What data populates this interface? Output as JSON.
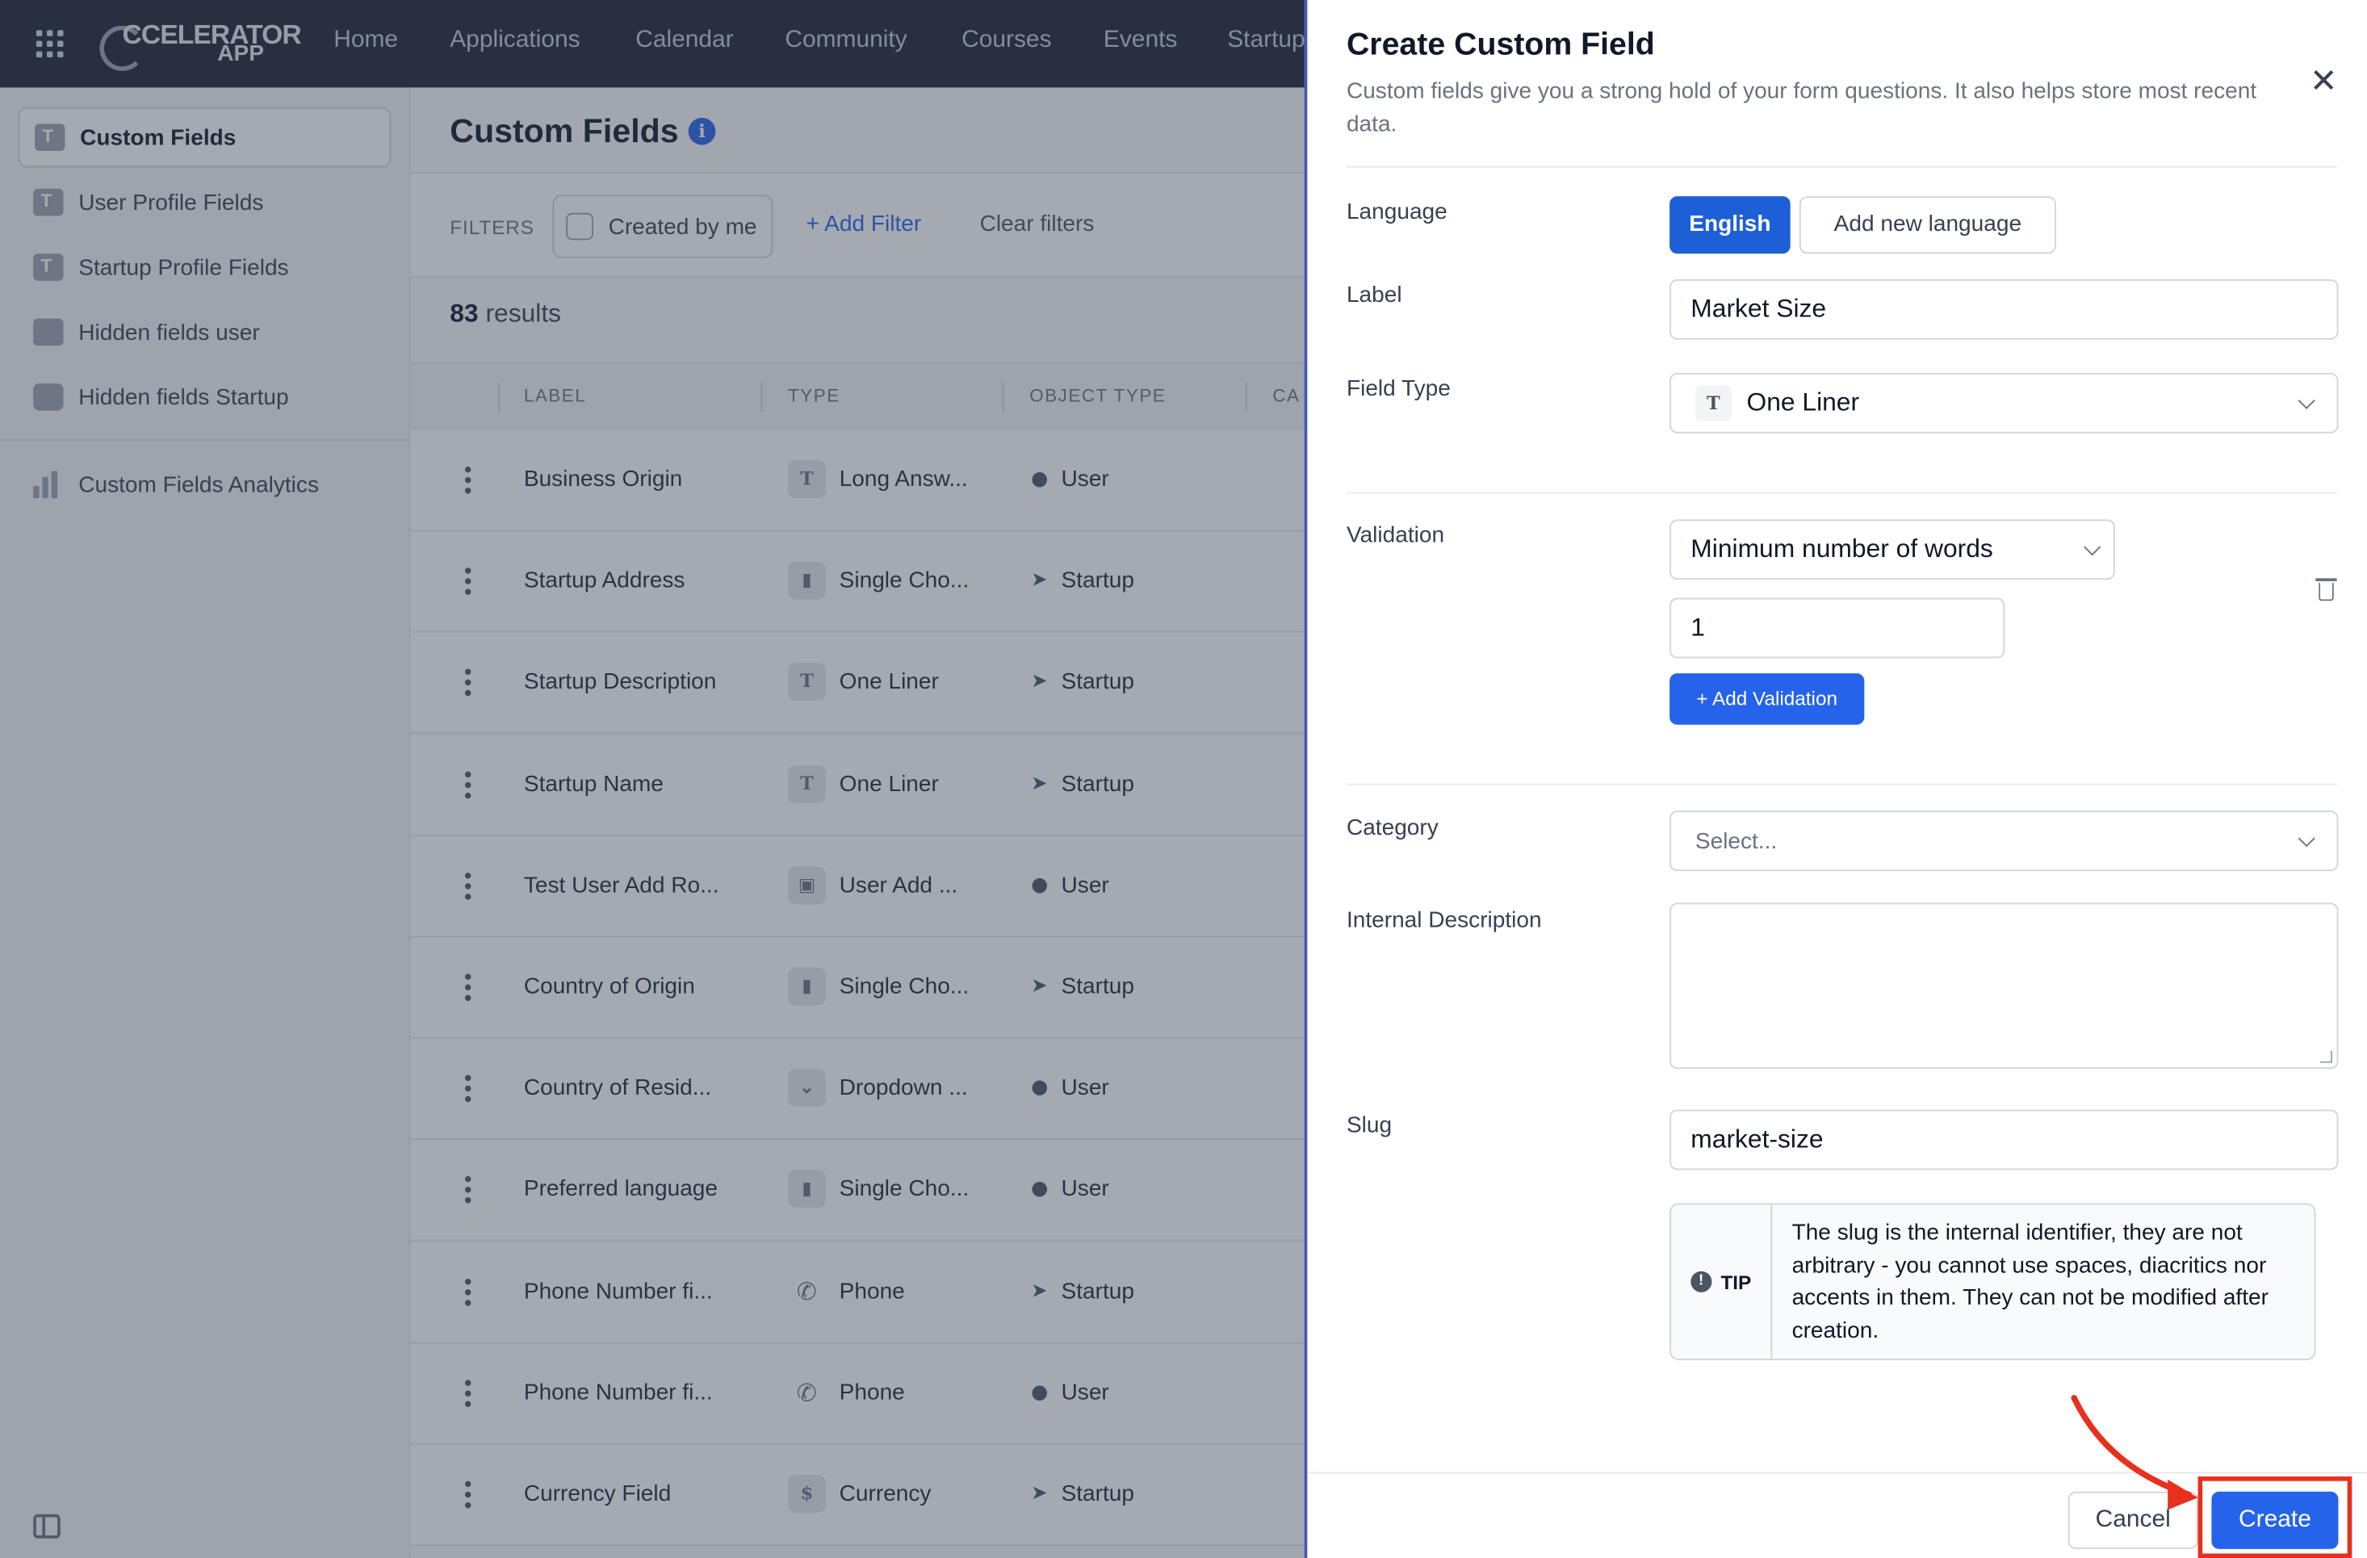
{
  "topnav": {
    "logo_line1": "CCELERATOR",
    "logo_line2": "APP",
    "items": [
      "Home",
      "Applications",
      "Calendar",
      "Community",
      "Courses",
      "Events",
      "Startup"
    ]
  },
  "sidebar": {
    "items": [
      {
        "label": "Custom Fields",
        "icon": "text-field-icon",
        "active": true
      },
      {
        "label": "User Profile Fields",
        "icon": "text-field-icon"
      },
      {
        "label": "Startup Profile Fields",
        "icon": "text-field-icon"
      },
      {
        "label": "Hidden fields user",
        "icon": "id-card-icon"
      },
      {
        "label": "Hidden fields Startup",
        "icon": "briefcase-icon"
      },
      {
        "label": "Custom Fields Analytics",
        "icon": "bar-chart-icon"
      }
    ]
  },
  "main": {
    "title": "Custom Fields",
    "filters_label": "FILTERS",
    "created_by_me": "Created by me",
    "add_filter": "+ Add Filter",
    "clear_filters": "Clear filters",
    "results_count": "83",
    "results_suffix": " results",
    "columns": [
      "LABEL",
      "TYPE",
      "OBJECT TYPE",
      "CA"
    ],
    "rows": [
      {
        "label": "Business Origin",
        "type": "Long Answ...",
        "type_icon": "T",
        "object": "User",
        "object_icon": "user"
      },
      {
        "label": "Startup Address",
        "type": "Single Cho...",
        "type_icon": "▮",
        "object": "Startup",
        "object_icon": "rocket"
      },
      {
        "label": "Startup Description",
        "type": "One Liner",
        "type_icon": "T",
        "object": "Startup",
        "object_icon": "rocket"
      },
      {
        "label": "Startup Name",
        "type": "One Liner",
        "type_icon": "T",
        "object": "Startup",
        "object_icon": "rocket"
      },
      {
        "label": "Test User Add Ro...",
        "type": "User Add ...",
        "type_icon": "▣",
        "object": "User",
        "object_icon": "user"
      },
      {
        "label": "Country of Origin",
        "type": "Single Cho...",
        "type_icon": "▮",
        "object": "Startup",
        "object_icon": "rocket"
      },
      {
        "label": "Country of Resid...",
        "type": "Dropdown ...",
        "type_icon": "⌄",
        "object": "User",
        "object_icon": "user"
      },
      {
        "label": "Preferred language",
        "type": "Single Cho...",
        "type_icon": "▮",
        "object": "User",
        "object_icon": "user"
      },
      {
        "label": "Phone Number fi...",
        "type": "Phone",
        "type_icon": "✆",
        "object": "Startup",
        "object_icon": "rocket"
      },
      {
        "label": "Phone Number fi...",
        "type": "Phone",
        "type_icon": "✆",
        "object": "User",
        "object_icon": "user"
      },
      {
        "label": "Currency Field",
        "type": "Currency",
        "type_icon": "$",
        "object": "Startup",
        "object_icon": "rocket"
      }
    ]
  },
  "drawer": {
    "title": "Create Custom Field",
    "subtitle": "Custom fields give you a strong hold of your form questions. It also helps store most recent data.",
    "language_label": "Language",
    "language_active": "English",
    "add_language": "Add new language",
    "label_label": "Label",
    "label_value": "Market Size",
    "field_type_label": "Field Type",
    "field_type_value": "One Liner",
    "validation_label": "Validation",
    "validation_rule": "Minimum number of words",
    "validation_value": "1",
    "add_validation": "+ Add Validation",
    "category_label": "Category",
    "category_placeholder": "Select...",
    "internal_description_label": "Internal Description",
    "slug_label": "Slug",
    "slug_value": "market-size",
    "tip_label": "TIP",
    "tip_text": "The slug is the internal identifier, they are not arbitrary - you cannot use spaces, diacritics nor accents in them. They can not be modified after creation.",
    "cancel": "Cancel",
    "create": "Create"
  },
  "colors": {
    "nav_bg": "#1a2233",
    "primary": "#2563eb",
    "highlight": "#e8301c"
  }
}
